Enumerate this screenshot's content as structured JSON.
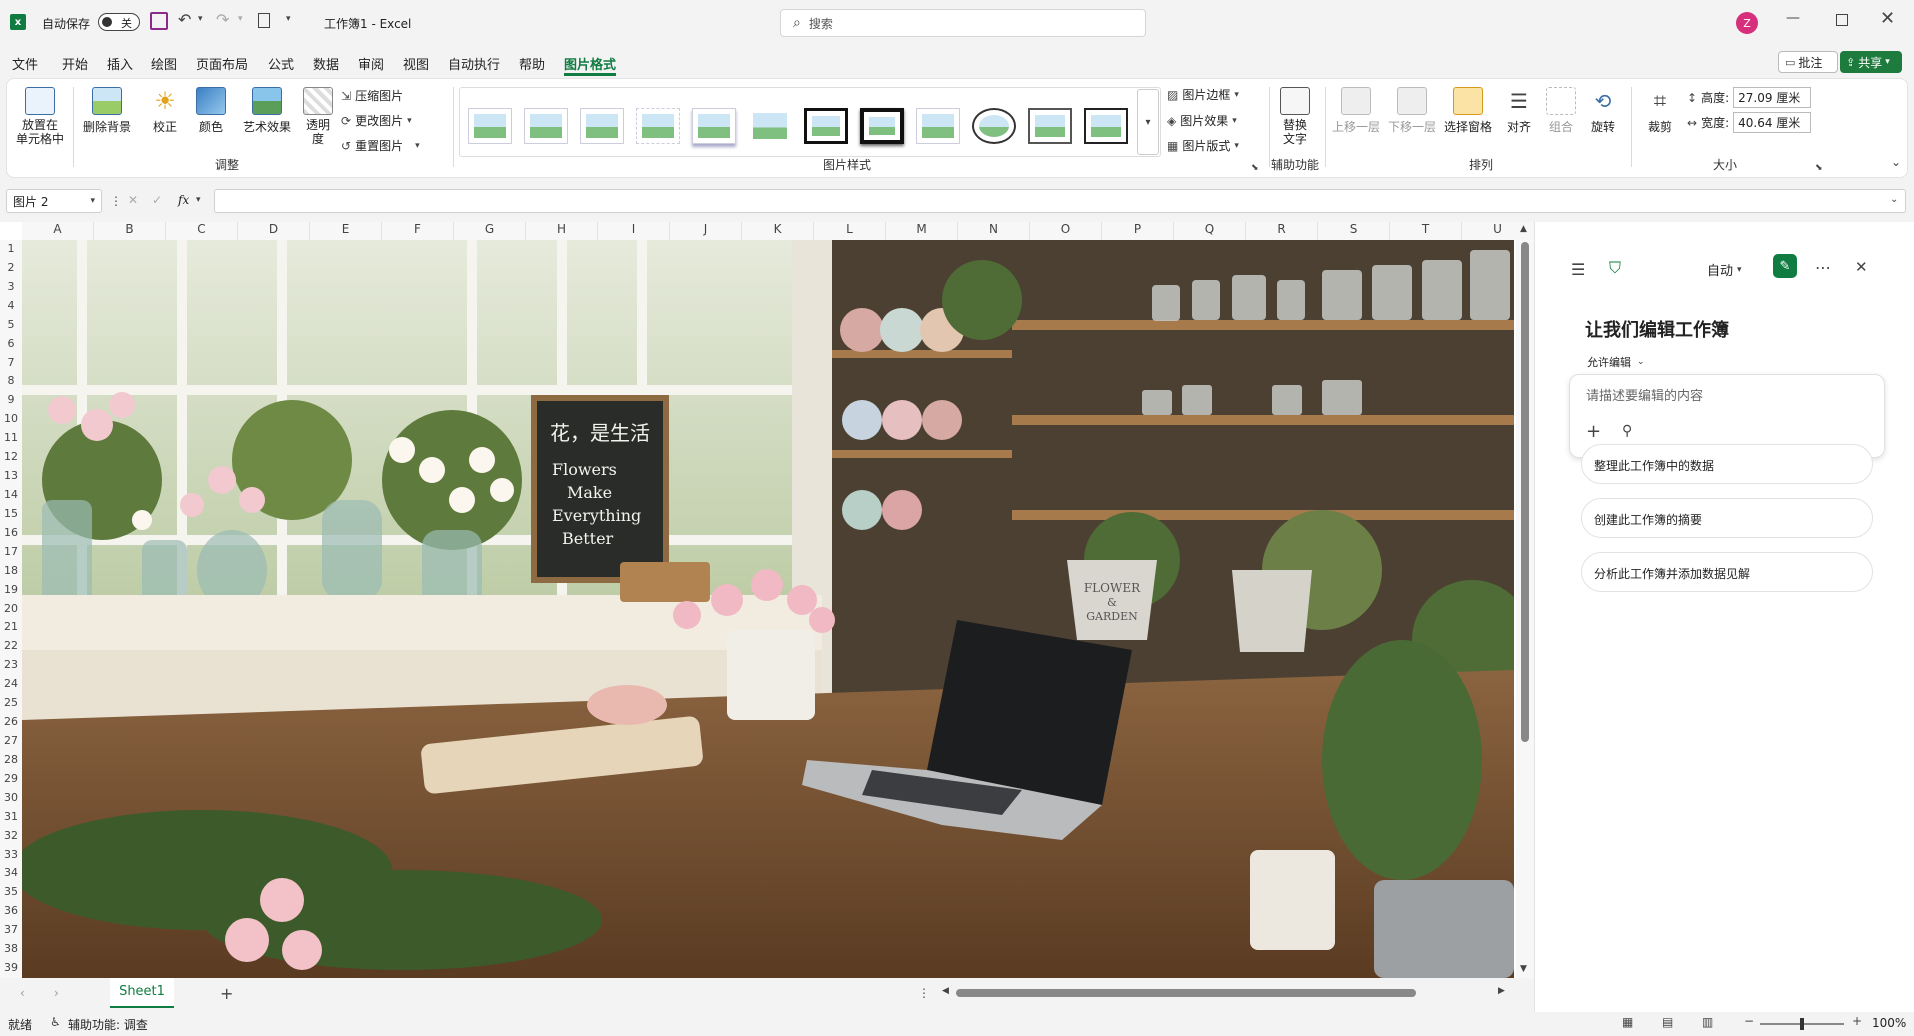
{
  "titlebar": {
    "autosave_label": "自动保存",
    "autosave_state": "关",
    "doc_title": "工作簿1 - Excel",
    "search_placeholder": "搜索",
    "avatar_letter": "Z"
  },
  "menu": {
    "tabs": [
      "文件",
      "开始",
      "插入",
      "绘图",
      "页面布局",
      "公式",
      "数据",
      "审阅",
      "视图",
      "自动执行",
      "帮助",
      "图片格式"
    ],
    "active_tab": "图片格式",
    "comment_label": "批注",
    "share_label": "共享"
  },
  "ribbon": {
    "place_in_cell": "放置在\n单元格中",
    "remove_bg": "删除背景",
    "correct": "校正",
    "color": "颜色",
    "art_effects": "艺术效果",
    "transparency": "透明\n度",
    "compress": "压缩图片",
    "change_pic": "更改图片",
    "reset_pic": "重置图片",
    "group_adjust": "调整",
    "group_styles": "图片样式",
    "pic_border": "图片边框",
    "pic_effects": "图片效果",
    "pic_layout": "图片版式",
    "alt_text": "替换\n文字",
    "group_access": "辅助功能",
    "bring_forward": "上移一层",
    "send_backward": "下移一层",
    "selection_pane": "选择窗格",
    "align": "对齐",
    "group_obj": "组合",
    "rotate": "旋转",
    "group_arrange": "排列",
    "crop": "裁剪",
    "height_label": "高度:",
    "height_value": "27.09 厘米",
    "width_label": "宽度:",
    "width_value": "40.64 厘米",
    "group_size": "大小"
  },
  "formula": {
    "name_box": "图片 2",
    "fx": "fx"
  },
  "grid": {
    "columns": [
      "A",
      "B",
      "C",
      "D",
      "E",
      "F",
      "G",
      "H",
      "I",
      "J",
      "K",
      "L",
      "M",
      "N",
      "O",
      "P",
      "Q",
      "R",
      "S",
      "T",
      "U"
    ],
    "rows": [
      "1",
      "2",
      "3",
      "4",
      "5",
      "6",
      "7",
      "8",
      "9",
      "10",
      "11",
      "12",
      "13",
      "14",
      "15",
      "16",
      "17",
      "18",
      "19",
      "20",
      "21",
      "22",
      "23",
      "24",
      "25",
      "26",
      "27",
      "28",
      "29",
      "30",
      "31",
      "32",
      "33",
      "34",
      "35",
      "36",
      "37",
      "38",
      "39"
    ]
  },
  "photo": {
    "chalk_title": "花，是生活",
    "chalk_lines": [
      "Flowers",
      "Make",
      "Everything",
      "Better"
    ],
    "pot_text": [
      "FLOWER",
      "&",
      "GARDEN"
    ]
  },
  "pane": {
    "mode": "自动",
    "heading": "让我们编辑工作簿",
    "permission": "允许编辑",
    "input_placeholder": "请描述要编辑的内容",
    "suggestions": [
      "整理此工作簿中的数据",
      "创建此工作簿的摘要",
      "分析此工作簿并添加数据见解"
    ]
  },
  "sheets": {
    "active": "Sheet1"
  },
  "status": {
    "ready": "就绪",
    "accessibility": "辅助功能: 调查",
    "zoom": "100%"
  },
  "colors": {
    "excel_green": "#107c41",
    "share_green": "#1e7b3e",
    "avatar_pink": "#d62f7b"
  }
}
